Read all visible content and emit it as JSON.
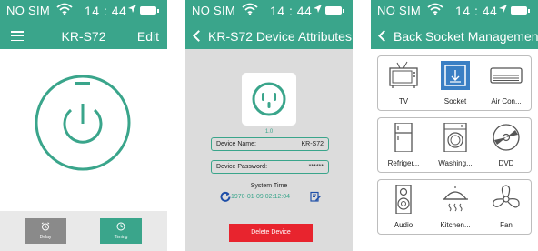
{
  "colors": {
    "accent": "#3aa58b",
    "delete": "#e8242e",
    "gray_bg": "#dcdcdc"
  },
  "status": {
    "carrier": "NO SIM",
    "time": "14 : 44"
  },
  "phone1": {
    "title": "KR-S72",
    "edit": "Edit",
    "delay_label": "Delay",
    "timing_label": "Timing"
  },
  "phone2": {
    "back_title": "KR-S72  Device Attributes",
    "version": "1.0",
    "device_name_label": "Device Name:",
    "device_name_value": "KR-S72",
    "device_password_label": "Device  Password:",
    "device_password_value": "******",
    "system_time_label": "System Time",
    "system_time_value": "1970-01-09   02:12:04",
    "delete_button": "Delete Device"
  },
  "phone3": {
    "back_title": "Back Socket Management",
    "items": [
      {
        "label": "TV",
        "icon": "tv-icon"
      },
      {
        "label": "Socket",
        "icon": "socket-icon"
      },
      {
        "label": "Air Con...",
        "icon": "air-conditioner-icon"
      },
      {
        "label": "Refriger...",
        "icon": "refrigerator-icon"
      },
      {
        "label": "Washing...",
        "icon": "washing-machine-icon"
      },
      {
        "label": "DVD",
        "icon": "dvd-icon"
      },
      {
        "label": "Audio",
        "icon": "audio-icon"
      },
      {
        "label": "Kitchen...",
        "icon": "kitchen-icon"
      },
      {
        "label": "Fan",
        "icon": "fan-icon"
      }
    ]
  }
}
